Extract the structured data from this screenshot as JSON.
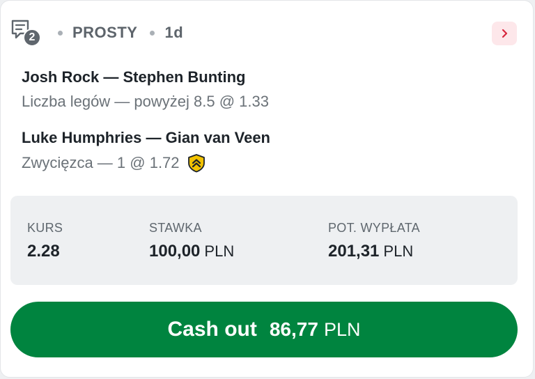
{
  "header": {
    "selections_count": "2",
    "bet_type": "PROSTY",
    "age": "1d"
  },
  "selections": [
    {
      "event": "Josh Rock — Stephen Bunting",
      "market": "Liczba legów — powyżej 8.5 @ 1.33",
      "boosted": false
    },
    {
      "event": "Luke Humphries — Gian van Veen",
      "market": "Zwycięzca — 1 @ 1.72",
      "boosted": true
    }
  ],
  "summary": {
    "odds_label": "KURS",
    "odds_value": "2.28",
    "stake_label": "STAWKA",
    "stake_value": "100,00",
    "stake_currency": "PLN",
    "payout_label": "POT. WYPŁATA",
    "payout_value": "201,31",
    "payout_currency": "PLN"
  },
  "cashout": {
    "label": "Cash out",
    "amount": "86,77",
    "currency": "PLN"
  },
  "colors": {
    "cashout_green": "#00843f",
    "boost_gold": "#f2c200",
    "expand_bg": "#fde7ea",
    "expand_chevron": "#d7263d"
  },
  "icons": {
    "bet_slip": "ticket-list-icon",
    "expand": "chevron-right-icon",
    "boost": "double-chevron-shield-icon"
  }
}
